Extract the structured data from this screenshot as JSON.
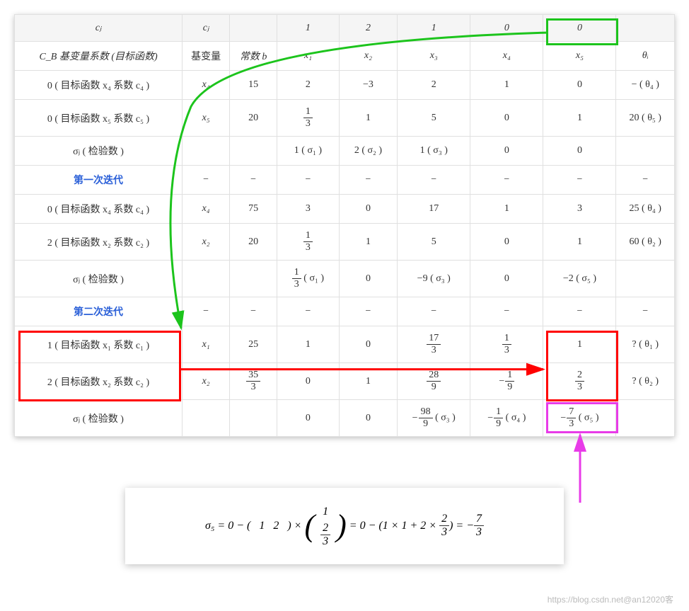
{
  "header": {
    "cj": "cⱼ",
    "cj2": "cⱼ",
    "h1": "1",
    "h2": "2",
    "h3": "1",
    "h4": "0",
    "h5": "0"
  },
  "sub": {
    "r0": "C_B 基变量系数 (目标函数)",
    "r1": "基变量",
    "r2": "常数 b",
    "x1": "x₁",
    "x2": "x₂",
    "x3": "x₃",
    "x4": "x₄",
    "x5": "x₅",
    "theta": "θᵢ"
  },
  "rows": {
    "a1": {
      "l": "0 ( 目标函数 x₄ 系数 c₄ )",
      "bv": "x₄",
      "b": "15",
      "v1": "2",
      "v2": "−3",
      "v3": "2",
      "v4": "1",
      "v5": "0",
      "t": "− ( θ₄ )"
    },
    "a2": {
      "l": "0 ( 目标函数 x₅ 系数 c₅ )",
      "bv": "x₅",
      "b": "20",
      "v1n": "1",
      "v1d": "3",
      "v2": "1",
      "v3": "5",
      "v4": "0",
      "v5": "1",
      "t": "20 ( θ₅ )"
    },
    "a3": {
      "l": "σⱼ ( 检验数 )",
      "v1": "1 ( σ₁ )",
      "v2": "2 ( σ₂ )",
      "v3": "1 ( σ₃ )",
      "v4": "0",
      "v5": "0"
    },
    "it1": "第一次迭代",
    "b1": {
      "l": "0 ( 目标函数 x₄ 系数 c₄ )",
      "bv": "x₄",
      "b": "75",
      "v1": "3",
      "v2": "0",
      "v3": "17",
      "v4": "1",
      "v5": "3",
      "t": "25 ( θ₄ )"
    },
    "b2": {
      "l": "2 ( 目标函数 x₂ 系数 c₂ )",
      "bv": "x₂",
      "b": "20",
      "v1n": "1",
      "v1d": "3",
      "v2": "1",
      "v3": "5",
      "v4": "0",
      "v5": "1",
      "t": "60 ( θ₂ )"
    },
    "b3": {
      "l": "σⱼ ( 检验数 )",
      "v1n_a": "1",
      "v1d_a": "3",
      "v1s": " ( σ₁ )",
      "v2": "0",
      "v3": "−9 ( σ₃ )",
      "v4": "0",
      "v5": "−2 ( σ₅ )"
    },
    "it2": "第二次迭代",
    "c1": {
      "l": "1 ( 目标函数 x₁ 系数 c₁ )",
      "bv": "x₁",
      "b": "25",
      "v1": "1",
      "v2": "0",
      "v3n": "17",
      "v3d": "3",
      "v4n": "1",
      "v4d": "3",
      "v5": "1",
      "t": "? ( θ₁ )"
    },
    "c2": {
      "l": "2 ( 目标函数 x₂ 系数 c₂ )",
      "bv": "x₂",
      "bn": "35",
      "bd": "3",
      "v1": "0",
      "v2": "1",
      "v3n": "28",
      "v3d": "9",
      "v4n": "1",
      "v4d": "9",
      "v4neg": "−",
      "v5n": "2",
      "v5d": "3",
      "t": "? ( θ₂ )"
    },
    "c3": {
      "l": "σⱼ ( 检验数 )",
      "v1": "0",
      "v2": "0",
      "v3neg": "−",
      "v3n": "98",
      "v3d": "9",
      "v3s": " ( σ₃ )",
      "v4neg": "−",
      "v4n": "1",
      "v4d": "9",
      "v4s": " ( σ₄ )",
      "v5neg": "−",
      "v5n": "7",
      "v5d": "3",
      "v5s": " ( σ₅ )"
    }
  },
  "formula": {
    "p1": "σ₅ = 0 − (",
    "m1": "1",
    "m2": "2",
    "p2": ") × ",
    "v1": "1",
    "v2n": "2",
    "v2d": "3",
    "p3": " = 0 − (1 × 1 + 2 × ",
    "fn": "2",
    "fd": "3",
    "p4": ") = −",
    "rn": "7",
    "rd": "3"
  },
  "watermark": "https://blog.csdn.net@an12020客",
  "dash": "−"
}
